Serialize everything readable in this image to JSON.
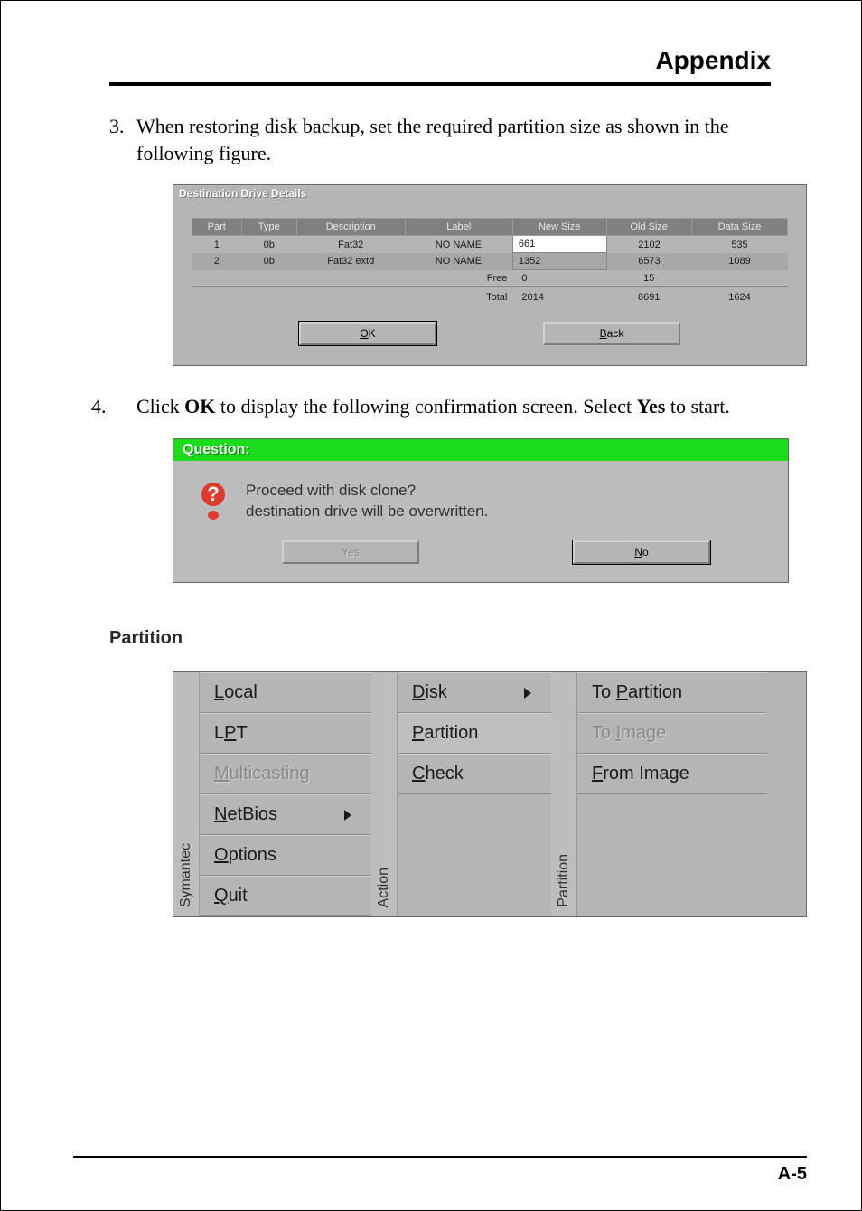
{
  "header": {
    "title": "Appendix"
  },
  "step3": {
    "num": "3.",
    "text": "When restoring disk backup, set the required partition size as shown in the following figure."
  },
  "fig1": {
    "title": "Destination Drive Details",
    "columns": [
      "Part",
      "Type",
      "Description",
      "Label",
      "New Size",
      "Old Size",
      "Data Size"
    ],
    "rows": [
      {
        "part": "1",
        "type": "0b",
        "desc": "Fat32",
        "label": "NO NAME",
        "new": "661",
        "old": "2102",
        "data": "535"
      },
      {
        "part": "2",
        "type": "0b",
        "desc": "Fat32 extd",
        "label": "NO NAME",
        "new": "1352",
        "old": "6573",
        "data": "1089"
      }
    ],
    "free": {
      "label": "Free",
      "new": "0",
      "old": "15",
      "data": ""
    },
    "total": {
      "label": "Total",
      "new": "2014",
      "old": "8691",
      "data": "1624"
    },
    "ok_label": "OK",
    "back_label": "Back"
  },
  "step4": {
    "num": "4.",
    "text_prefix": "Click ",
    "bold1": "OK",
    "text_mid": " to display the following confirmation screen.  Select ",
    "bold2": "Yes",
    "text_suffix": " to start."
  },
  "fig2": {
    "title": "Question:",
    "msg_line1": "Proceed with disk clone?",
    "msg_line2": "destination drive will be overwritten.",
    "yes_label": "Yes",
    "no_label": "No"
  },
  "section": {
    "heading": "Partition"
  },
  "fig3": {
    "side1": "Symantec",
    "col1": [
      {
        "label": "Local",
        "underline": "L",
        "rest": "ocal",
        "arrow": false,
        "disabled": false
      },
      {
        "label": "LPT",
        "underline": "P",
        "pre": "L",
        "rest": "T",
        "arrow": false,
        "disabled": false
      },
      {
        "label": "Multicasting",
        "underline": "M",
        "rest": "ulticasting",
        "arrow": false,
        "disabled": true
      },
      {
        "label": "NetBios",
        "underline": "N",
        "rest": "etBios",
        "arrow": true,
        "disabled": false
      },
      {
        "label": "Options",
        "underline": "O",
        "rest": "ptions",
        "arrow": false,
        "disabled": false
      },
      {
        "label": "Quit",
        "underline": "Q",
        "rest": "uit",
        "arrow": false,
        "disabled": false
      }
    ],
    "side2": "Action",
    "col2": [
      {
        "label": "Disk",
        "underline": "D",
        "rest": "isk",
        "arrow": true
      },
      {
        "label": "Partition",
        "underline": "P",
        "rest": "artition",
        "arrow": false,
        "selected": true
      },
      {
        "label": "Check",
        "underline": "C",
        "rest": "heck",
        "arrow": false
      }
    ],
    "side3": "Partition",
    "col3": [
      {
        "label": "To Partition",
        "pre": "To ",
        "underline": "P",
        "rest": "artition",
        "disabled": false
      },
      {
        "label": "To Image",
        "pre": "To ",
        "underline": "I",
        "rest": "mage",
        "disabled": true
      },
      {
        "label": "From Image",
        "underline": "F",
        "rest": "rom Image",
        "disabled": false
      }
    ]
  },
  "page_number": "A-5"
}
